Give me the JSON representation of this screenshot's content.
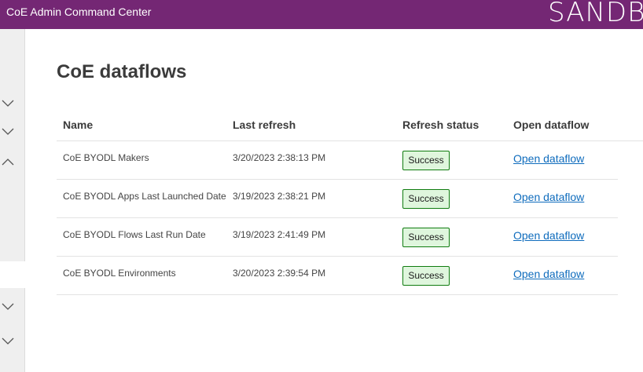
{
  "header": {
    "app_title": "CoE Admin Command Center",
    "environment_label": "SANDB",
    "background_color": "#742774"
  },
  "sidebar": {
    "chevrons": [
      "chevron-down-icon",
      "chevron-down-icon",
      "chevron-up-icon",
      "chevron-down-icon",
      "chevron-down-icon"
    ]
  },
  "main": {
    "page_title": "CoE dataflows",
    "columns": [
      "Name",
      "Last refresh",
      "Refresh status",
      "Open dataflow"
    ],
    "rows": [
      {
        "name": "CoE BYODL Makers",
        "last_refresh": "3/20/2023 2:38:13 PM",
        "status": "Success",
        "link": "Open dataflow"
      },
      {
        "name": "CoE BYODL Apps Last Launched Date",
        "last_refresh": "3/19/2023 2:38:21 PM",
        "status": "Success",
        "link": "Open dataflow"
      },
      {
        "name": "CoE BYODL Flows Last Run Date",
        "last_refresh": "3/19/2023 2:41:49 PM",
        "status": "Success",
        "link": "Open dataflow"
      },
      {
        "name": "CoE BYODL Environments",
        "last_refresh": "3/20/2023 2:39:54 PM",
        "status": "Success",
        "link": "Open dataflow"
      }
    ],
    "status_color": "#107c10",
    "link_color": "#0f6cbd"
  }
}
